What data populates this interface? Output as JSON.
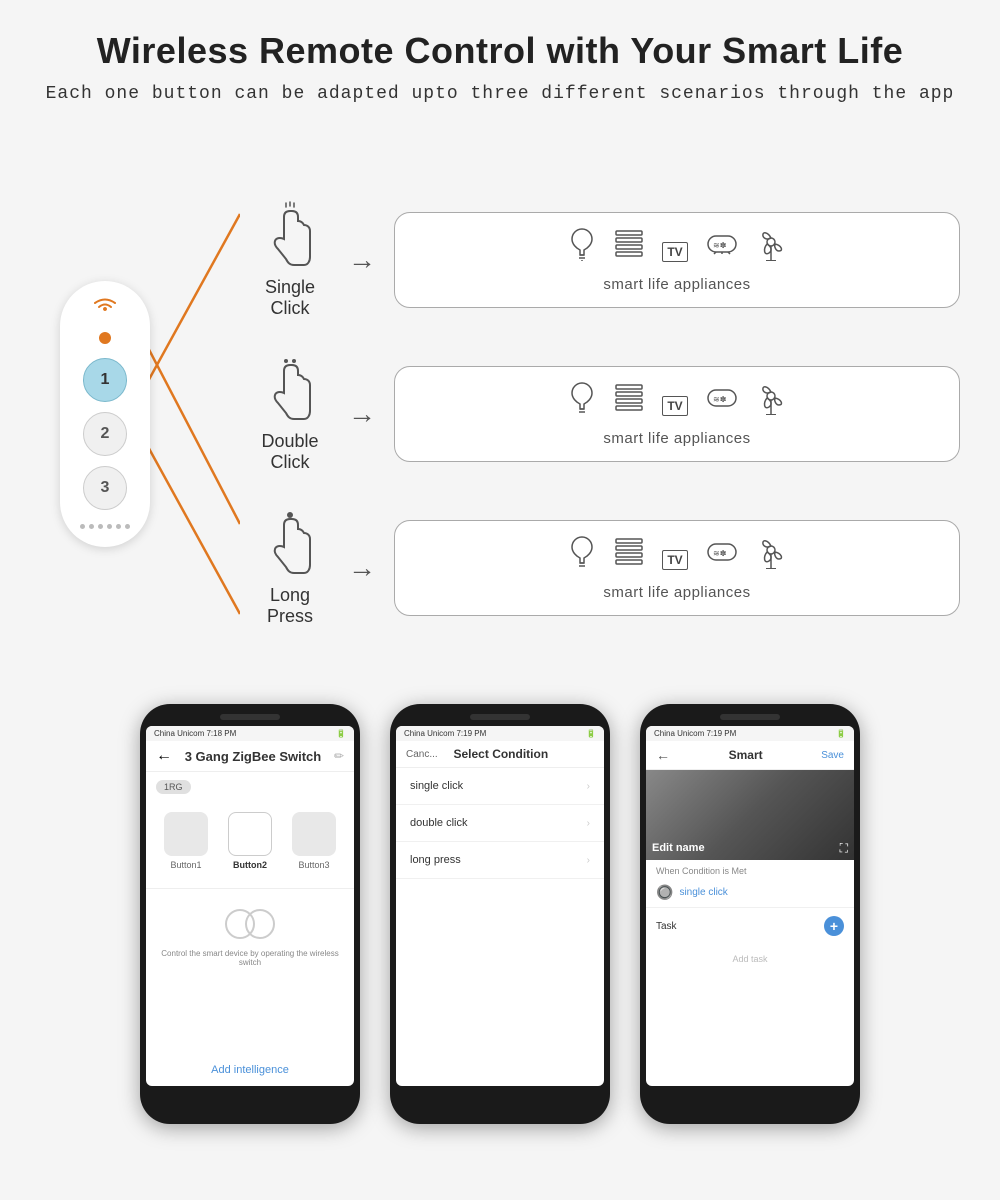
{
  "page": {
    "title": "Wireless Remote Control with Your Smart Life",
    "subtitle": "Each one button can be adapted upto three different scenarios through the app"
  },
  "interactions": [
    {
      "label": "Single Click",
      "appliance_label": "smart life appliances"
    },
    {
      "label": "Double Click",
      "appliance_label": "smart life appliances"
    },
    {
      "label": "Long Press",
      "appliance_label": "smart life appliances"
    }
  ],
  "remote": {
    "buttons": [
      "1",
      "2",
      "3"
    ]
  },
  "phones": [
    {
      "id": "phone1",
      "status_bar": "China Unicom  7:18 PM",
      "header_title": "3 Gang ZigBee Switch",
      "tag": "1RG",
      "btn_labels": [
        "Button1",
        "Button2",
        "Button3"
      ],
      "description": "Control the smart device by operating the wireless switch",
      "footer_btn": "Add intelligence"
    },
    {
      "id": "phone2",
      "status_bar": "China Unicom  7:19 PM",
      "header_title": "Select Condition",
      "cancel_label": "Canc...",
      "list_items": [
        "single click",
        "double click",
        "long press"
      ]
    },
    {
      "id": "phone3",
      "status_bar": "China Unicom  7:19 PM",
      "header_title": "Smart",
      "save_label": "Save",
      "edit_name": "Edit name",
      "section_label": "When Condition is Met",
      "condition_text": "single click",
      "task_label": "Task",
      "add_task_label": "Add task"
    }
  ]
}
